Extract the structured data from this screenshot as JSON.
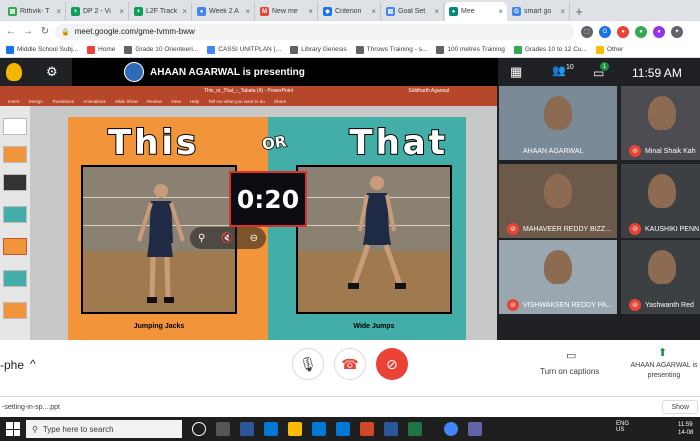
{
  "browser": {
    "tabs": [
      {
        "label": "Rithvik- T",
        "fav_color": "#34a853",
        "fav_glyph": "▤"
      },
      {
        "label": "DP 2 - Vi",
        "fav_color": "#0f9d58",
        "fav_glyph": "+"
      },
      {
        "label": "L2F Track",
        "fav_color": "#0f9d58",
        "fav_glyph": "+"
      },
      {
        "label": "Week 2 A",
        "fav_color": "#4285f4",
        "fav_glyph": "●"
      },
      {
        "label": "New me",
        "fav_color": "#ea4335",
        "fav_glyph": "M"
      },
      {
        "label": "Criterion",
        "fav_color": "#1a73e8",
        "fav_glyph": "◆"
      },
      {
        "label": "Goal Set",
        "fav_color": "#4285f4",
        "fav_glyph": "▤"
      },
      {
        "label": "Mee",
        "fav_color": "#00897b",
        "fav_glyph": "●",
        "active": true
      },
      {
        "label": "smart go",
        "fav_color": "#4285f4",
        "fav_glyph": "G"
      }
    ],
    "url": "meet.google.com/gme-tvmm-bww",
    "bookmarks": [
      {
        "label": "Middle School Subj...",
        "color": "#1a73e8"
      },
      {
        "label": "Home",
        "color": "#ea4335"
      },
      {
        "label": "Grade 10 Orienteeri...",
        "color": "#5f6368"
      },
      {
        "label": "CASSI UNITPLAN (...",
        "color": "#4285f4"
      },
      {
        "label": "Library Genesis",
        "color": "#5f6368"
      },
      {
        "label": "Throws Training - s...",
        "color": "#5f6368"
      },
      {
        "label": "100 metres Training",
        "color": "#5f6368"
      },
      {
        "label": "Grades 10 to 12 Cu...",
        "color": "#34a853"
      },
      {
        "label": "Other",
        "color": "#fbbc04"
      }
    ]
  },
  "meet": {
    "presenter_banner": "AHAAN AGARWAL is presenting",
    "participant_count": "10",
    "chat_count": "1",
    "clock": "11:59 AM",
    "meeting_code": "-phe",
    "captions_label": "Turn on captions",
    "presenting_label": "AHAAN AGARWAL is presenting",
    "participants": [
      {
        "name": "AHAAN AGARWAL",
        "color": "#7a8a96",
        "muted": false
      },
      {
        "name": "Minal Shaik Kah",
        "color": "#4d4c52",
        "muted": true
      },
      {
        "name": "MAHAVEER REDDY BIZZ...",
        "color": "#6b5a4a",
        "muted": true
      },
      {
        "name": "KAUSHIKI PENN",
        "color": "#3c4043",
        "muted": true
      },
      {
        "name": "VISHWAKSEN REDDY PA...",
        "color": "#9aa6b0",
        "muted": true
      },
      {
        "name": "Yashwanth Red",
        "color": "#3c4043",
        "muted": true
      }
    ]
  },
  "ppt": {
    "doc_title": "This_or_That_-_Tabata (4)  -  PowerPoint",
    "user": "Siddharth Agarwal",
    "ribbon": [
      "Insert",
      "Design",
      "Transitions",
      "Animations",
      "Slide Show",
      "Review",
      "View",
      "Help",
      "Tell me what you want to do",
      "Share"
    ]
  },
  "slide": {
    "title_left": "This",
    "title_or": "OR",
    "title_right": "That",
    "timer": "0:20",
    "caption_left": "Jumping Jacks",
    "caption_right": "Wide Jumps",
    "colors": {
      "left": "#f2953a",
      "right": "#43aea8"
    }
  },
  "downloads": {
    "file": "-setting-in-sp....ppt",
    "show_all": "Show"
  },
  "taskbar": {
    "search_placeholder": "Type here to search",
    "lang": "ENG",
    "region": "US",
    "time": "11:59",
    "date": "14-08"
  }
}
